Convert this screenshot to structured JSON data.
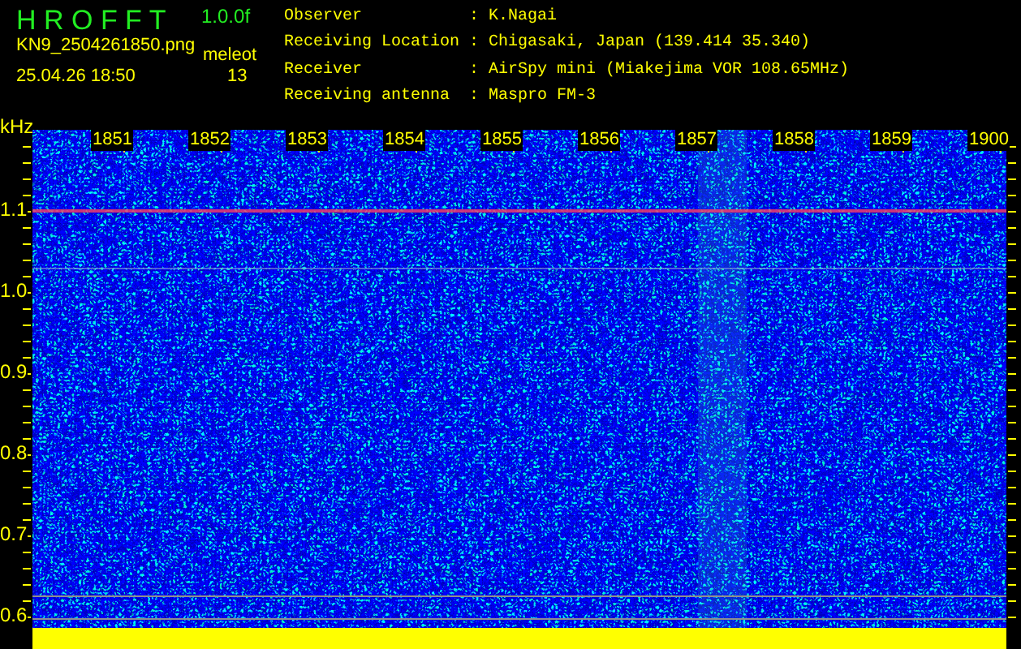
{
  "header": {
    "title": "H R O F F T",
    "version": "1.0.0f",
    "filename": "KN9_2504261850.png",
    "mode": "meleot",
    "datetime": "25.04.26 18:50",
    "count": "13"
  },
  "info": [
    {
      "label": "Observer",
      "separator": ":",
      "value": "K.Nagai"
    },
    {
      "label": "Receiving Location",
      "separator": ":",
      "value": "Chigasaki, Japan (139.414 35.340)"
    },
    {
      "label": "Receiver",
      "separator": ":",
      "value": "AirSpy mini (Miakejima VOR 108.65MHz)"
    },
    {
      "label": "Receiving antenna",
      "separator": ":",
      "value": "Maspro FM-3"
    }
  ],
  "spectrogram": {
    "unit": "kHz",
    "time_labels": [
      "1851",
      "1852",
      "1853",
      "1854",
      "1855",
      "1856",
      "1857",
      "1858",
      "1859",
      "1900"
    ],
    "freq_labels": [
      "1.1",
      "1.0",
      "0.9",
      "0.8",
      "0.7",
      "0.6"
    ]
  }
}
